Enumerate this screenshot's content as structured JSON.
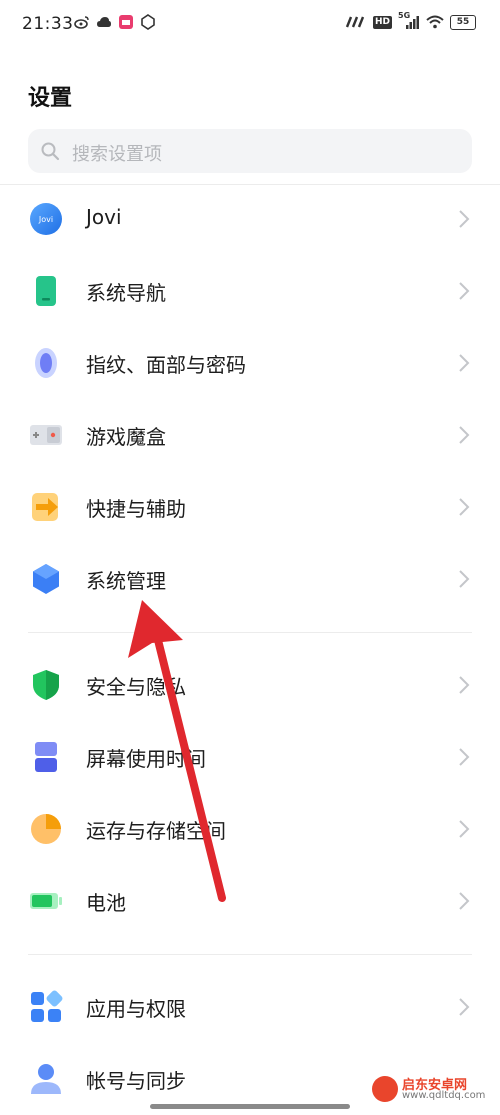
{
  "status_bar": {
    "time": "21:33",
    "icons_left": [
      "weibo-icon",
      "cloud-icon",
      "app-notification-icon",
      "shield-outline-icon"
    ],
    "icons_right": [
      "network-speed-icon",
      "hd-icon",
      "5g-signal-icon",
      "wifi-icon",
      "battery-icon"
    ],
    "network_label": "5G",
    "hd_label": "HD",
    "battery_level": "55"
  },
  "header": {
    "title": "设置"
  },
  "search": {
    "placeholder": "搜索设置项"
  },
  "groups": [
    {
      "items": [
        {
          "label": "Jovi",
          "icon": "jovi-icon",
          "icon_text": "Jovi"
        },
        {
          "label": "系统导航",
          "icon": "phone-navigation-icon"
        },
        {
          "label": "指纹、面部与密码",
          "icon": "fingerprint-icon"
        },
        {
          "label": "游戏魔盒",
          "icon": "game-box-icon"
        },
        {
          "label": "快捷与辅助",
          "icon": "shortcut-arrow-icon"
        },
        {
          "label": "系统管理",
          "icon": "hexagon-system-icon"
        }
      ]
    },
    {
      "items": [
        {
          "label": "安全与隐私",
          "icon": "security-shield-icon"
        },
        {
          "label": "屏幕使用时间",
          "icon": "hourglass-icon"
        },
        {
          "label": "运存与存储空间",
          "icon": "storage-pie-icon"
        },
        {
          "label": "电池",
          "icon": "battery-green-icon"
        }
      ]
    },
    {
      "items": [
        {
          "label": "应用与权限",
          "icon": "apps-grid-icon"
        },
        {
          "label": "帐号与同步",
          "icon": "account-person-icon"
        }
      ]
    }
  ],
  "watermark": {
    "title": "启东安卓网",
    "url": "www.qdltdq.com"
  },
  "colors": {
    "accent_blue": "#3b82f6",
    "green": "#22c55e",
    "orange": "#f59e0b",
    "annotation_red": "#e0282e"
  }
}
